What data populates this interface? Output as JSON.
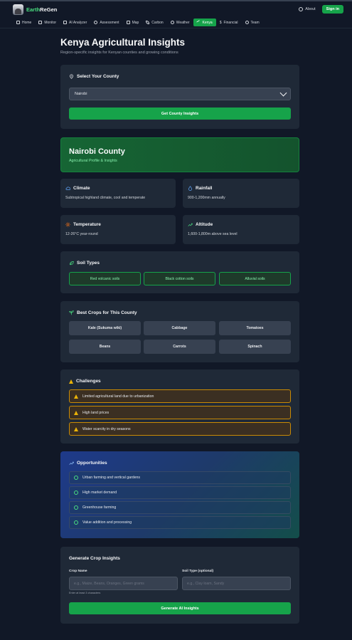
{
  "app": {
    "brand_a": "Earth",
    "brand_b": "ReGen",
    "about": "About",
    "signin": "Sign in"
  },
  "nav": [
    {
      "label": "Home",
      "icon": "home-icon"
    },
    {
      "label": "Monitor",
      "icon": "chart-icon"
    },
    {
      "label": "AI Analyzer",
      "icon": "sparkle-icon"
    },
    {
      "label": "Assessment",
      "icon": "check-circle-icon"
    },
    {
      "label": "Map",
      "icon": "map-icon"
    },
    {
      "label": "Carbon",
      "icon": "leaf-icon"
    },
    {
      "label": "Weather",
      "icon": "cloud-icon"
    },
    {
      "label": "Kenya",
      "icon": "trend-icon",
      "active": true
    },
    {
      "label": "Financial",
      "icon": "dollar-icon"
    },
    {
      "label": "Team",
      "icon": "users-icon"
    }
  ],
  "page": {
    "title": "Kenya Agricultural Insights",
    "subtitle": "Region-specific insights for Kenyan counties and growing conditions"
  },
  "county_select": {
    "title": "Select Your County",
    "value": "Nairobi",
    "button": "Get County Insights"
  },
  "county": {
    "name": "Nairobi County",
    "sub": "Agricultural Profile & Insights"
  },
  "info": {
    "climate": {
      "label": "Climate",
      "value": "Subtropical highland climate, cool and temperate"
    },
    "rainfall": {
      "label": "Rainfall",
      "value": "900-1,200mm annually"
    },
    "temperature": {
      "label": "Temperature",
      "value": "12-26°C year-round"
    },
    "altitude": {
      "label": "Altitude",
      "value": "1,600-1,800m above sea level"
    }
  },
  "soil": {
    "title": "Soil Types",
    "items": [
      "Red volcanic soils",
      "Black cotton soils",
      "Alluvial soils"
    ]
  },
  "crops": {
    "title": "Best Crops for This County",
    "items": [
      "Kale (Sukuma wiki)",
      "Cabbage",
      "Tomatoes",
      "Beans",
      "Carrots",
      "Spinach"
    ]
  },
  "challenges": {
    "title": "Challenges",
    "items": [
      "Limited agricultural land due to urbanization",
      "High land prices",
      "Water scarcity in dry seasons"
    ]
  },
  "opportunities": {
    "title": "Opportunities",
    "items": [
      "Urban farming and vertical gardens",
      "High market demand",
      "Greenhouse farming",
      "Value addition and processing"
    ]
  },
  "generate": {
    "title": "Generate Crop Insights",
    "crop_label": "Crop Name",
    "crop_placeholder": "e.g., Maize, Beans, Oranges, Green grams",
    "crop_hint": "Enter at least 3 characters",
    "soil_label": "Soil Type (optional)",
    "soil_placeholder": "e.g., Clay loam, Sandy",
    "button": "Generate AI Insights"
  },
  "colors": {
    "accent": "#16a34a",
    "warning": "#ca8a04",
    "background": "#111827",
    "card": "#1f2937"
  }
}
